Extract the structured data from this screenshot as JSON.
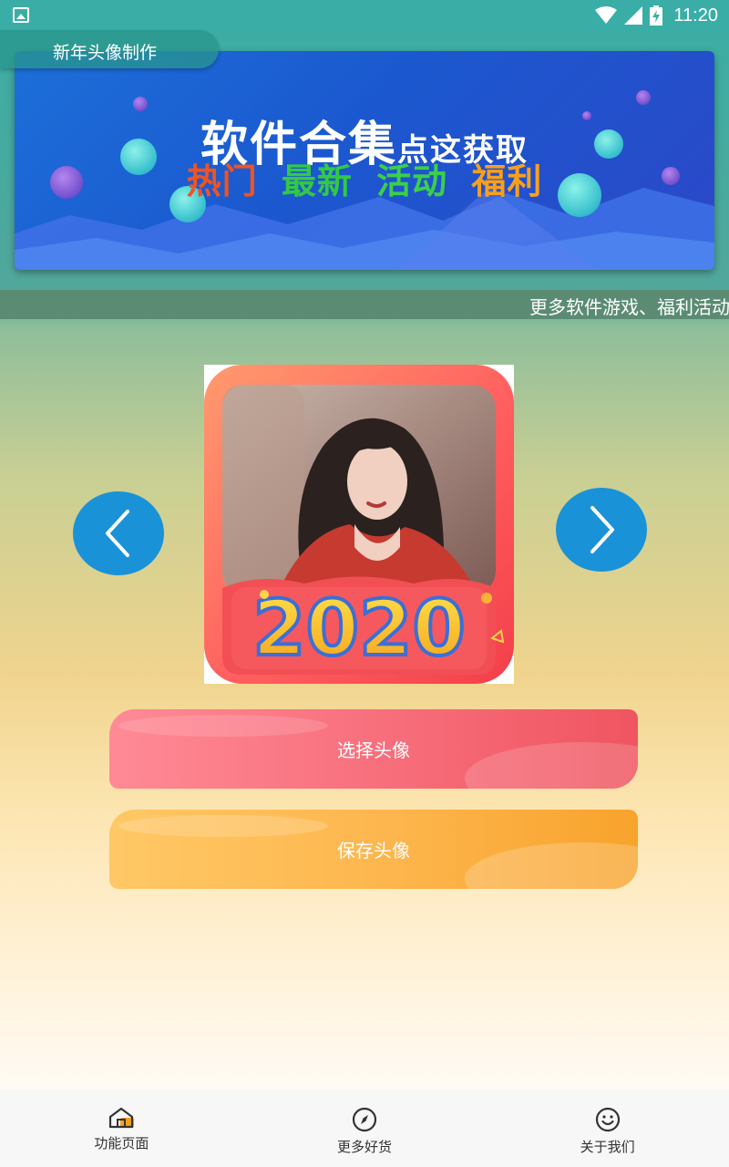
{
  "status_bar": {
    "time": "11:20",
    "icons": [
      "gallery-notification-icon",
      "wifi-icon",
      "signal-icon",
      "battery-charging-icon"
    ]
  },
  "app": {
    "title": "新年头像制作"
  },
  "banner": {
    "headline": "软件合集",
    "headline_suffix": "点这获取",
    "tags": [
      {
        "text": "热门",
        "color": "#f2531f"
      },
      {
        "text": "最新",
        "color": "#33c943"
      },
      {
        "text": "活动",
        "color": "#3ccf4a"
      },
      {
        "text": "福利",
        "color": "#f7c81e",
        "color2": "#ff7a22"
      }
    ]
  },
  "marquee": {
    "text": "更多软件游戏、福利活动"
  },
  "avatar": {
    "year_badge": "2020",
    "prev_icon": "chevron-left-icon",
    "next_icon": "chevron-right-icon"
  },
  "actions": {
    "choose_label": "选择头像",
    "save_label": "保存头像"
  },
  "bottom_nav": {
    "items": [
      {
        "label": "功能页面",
        "icon": "home-icon"
      },
      {
        "label": "更多好货",
        "icon": "compass-icon"
      },
      {
        "label": "关于我们",
        "icon": "smile-icon"
      }
    ]
  },
  "colors": {
    "accent_teal": "#3aaea6",
    "arrow_blue": "#1a92d8",
    "choose_button": "#f76d7a",
    "save_button": "#fdb54c"
  }
}
